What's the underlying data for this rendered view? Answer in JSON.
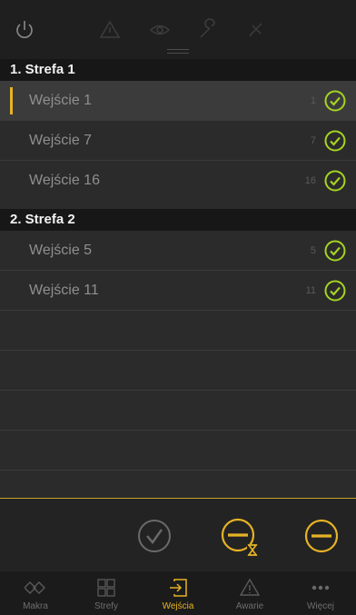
{
  "sections": [
    {
      "title": "1. Strefa 1",
      "rows": [
        {
          "label": "Wejście  1",
          "number": "1",
          "selected": true
        },
        {
          "label": "Wejście  7",
          "number": "7",
          "selected": false
        },
        {
          "label": "Wejście 16",
          "number": "16",
          "selected": false
        }
      ]
    },
    {
      "title": "2. Strefa 2",
      "rows": [
        {
          "label": "Wejście  5",
          "number": "5",
          "selected": false
        },
        {
          "label": "Wejście 11",
          "number": "11",
          "selected": false
        }
      ]
    }
  ],
  "toolbar_icons": [
    "power-icon",
    "warning-icon",
    "eye-icon",
    "wrench-icon",
    "bell-icon"
  ],
  "actions": [
    "check-circle-icon",
    "bypass-timer-icon",
    "minus-circle-icon"
  ],
  "tabs": [
    {
      "label": "Makra",
      "icon": "macro-icon",
      "active": false
    },
    {
      "label": "Strefy",
      "icon": "zones-icon",
      "active": false
    },
    {
      "label": "Wejścia",
      "icon": "inputs-icon",
      "active": true
    },
    {
      "label": "Awarie",
      "icon": "warning-icon",
      "active": false
    },
    {
      "label": "Więcej",
      "icon": "more-icon",
      "active": false
    }
  ],
  "colors": {
    "accent": "#e6b325",
    "check": "#a5d322",
    "background": "#2b2b2b"
  }
}
